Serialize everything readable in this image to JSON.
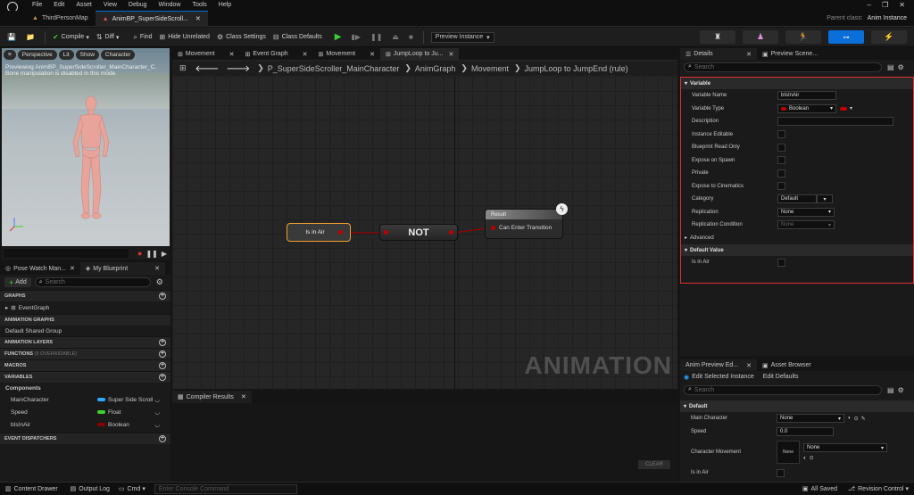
{
  "menu": [
    "File",
    "Edit",
    "Asset",
    "View",
    "Debug",
    "Window",
    "Tools",
    "Help"
  ],
  "tabs": [
    {
      "label": "ThirdPersonMap"
    },
    {
      "label": "AnimBP_SuperSideScroll..."
    }
  ],
  "parent_class": {
    "label": "Parent class:",
    "value": "Anim Instance"
  },
  "toolbar": {
    "compile": "Compile",
    "diff": "Diff",
    "find": "Find",
    "hide_unrelated": "Hide Unrelated",
    "class_settings": "Class Settings",
    "class_defaults": "Class Defaults",
    "preview_instance": "Preview Instance"
  },
  "viewport": {
    "buttons": [
      "Perspective",
      "Lit",
      "Show",
      "Character"
    ],
    "notice_line1": "Previewing AnimBP_SuperSideScroller_MainCharacter_C.",
    "notice_line2": "Bone manipulation is disabled in this mode."
  },
  "left_tabs": {
    "pose_watch": "Pose Watch Man...",
    "my_blueprint": "My Blueprint"
  },
  "my_blueprint": {
    "add": "Add",
    "search_placeholder": "Search",
    "graphs_head": "GRAPHS",
    "event_graph": "EventGraph",
    "anim_graphs_head": "ANIMATION GRAPHS",
    "default_shared_group": "Default Shared Group",
    "anim_layers": "ANIMATION LAYERS",
    "functions": "FUNCTIONS",
    "functions_count": "(5 OVERRIDABLE)",
    "macros": "MACROS",
    "variables": "VARIABLES",
    "components": "Components",
    "vars": [
      {
        "name": "MainCharacter",
        "type": "Super Side Scroll",
        "color": "#2ea8ff"
      },
      {
        "name": "Speed",
        "type": "Float",
        "color": "#3cd130"
      },
      {
        "name": "bIsInAir",
        "type": "Boolean",
        "color": "#8a0000"
      }
    ],
    "event_dispatchers": "EVENT DISPATCHERS"
  },
  "graph_tabs": [
    {
      "label": "Movement"
    },
    {
      "label": "Event Graph"
    },
    {
      "label": "Movement"
    },
    {
      "label": "JumpLoop to Ju..."
    }
  ],
  "breadcrumb": [
    "P_SuperSideScroller_MainCharacter",
    "AnimGraph",
    "Movement",
    "JumpLoop to JumpEnd (rule)"
  ],
  "graph": {
    "node_isinair": "Is in Air",
    "node_not": "NOT",
    "result_title": "Result",
    "result_pin": "Can Enter Transition",
    "watermark": "ANIMATION"
  },
  "compiler": {
    "tab": "Compiler Results",
    "clear": "CLEAR"
  },
  "details": {
    "tab": "Details",
    "tab2": "Preview Scene...",
    "search_placeholder": "Search",
    "section_variable": "Variable",
    "rows": {
      "variable_name": "Variable Name",
      "variable_name_value": "bIsInAir",
      "variable_type": "Variable Type",
      "variable_type_value": "Boolean",
      "description": "Description",
      "instance_editable": "Instance Editable",
      "blueprint_read_only": "Blueprint Read Only",
      "expose_on_spawn": "Expose on Spawn",
      "private": "Private",
      "expose_to_cinematics": "Expose to Cinematics",
      "category": "Category",
      "category_value": "Default",
      "replication": "Replication",
      "replication_value": "None",
      "replication_condition": "Replication Condition",
      "replication_condition_value": "None"
    },
    "advanced": "Advanced",
    "section_default": "Default Value",
    "is_in_air": "Is in Air"
  },
  "anim_preview": {
    "tab": "Anim Preview Ed...",
    "tab2": "Asset Browser",
    "edit_selected": "Edit Selected Instance",
    "edit_defaults": "Edit Defaults",
    "search_placeholder": "Search",
    "section": "Default",
    "main_character": "Main Character",
    "main_character_value": "None",
    "speed": "Speed",
    "speed_value": "0.0",
    "character_movement": "Character Movement",
    "character_movement_value": "None",
    "thumb_none": "None",
    "is_in_air": "Is in Air"
  },
  "status": {
    "content_drawer": "Content Drawer",
    "output_log": "Output Log",
    "cmd": "Cmd",
    "console_placeholder": "Enter Console Command",
    "all_saved": "All Saved",
    "revision_control": "Revision Control"
  },
  "colors": {
    "accent": "#0a6fd8",
    "highlight_border": "#e03030",
    "bool_pin": "#c00000",
    "selected_node": "#f0a030"
  }
}
